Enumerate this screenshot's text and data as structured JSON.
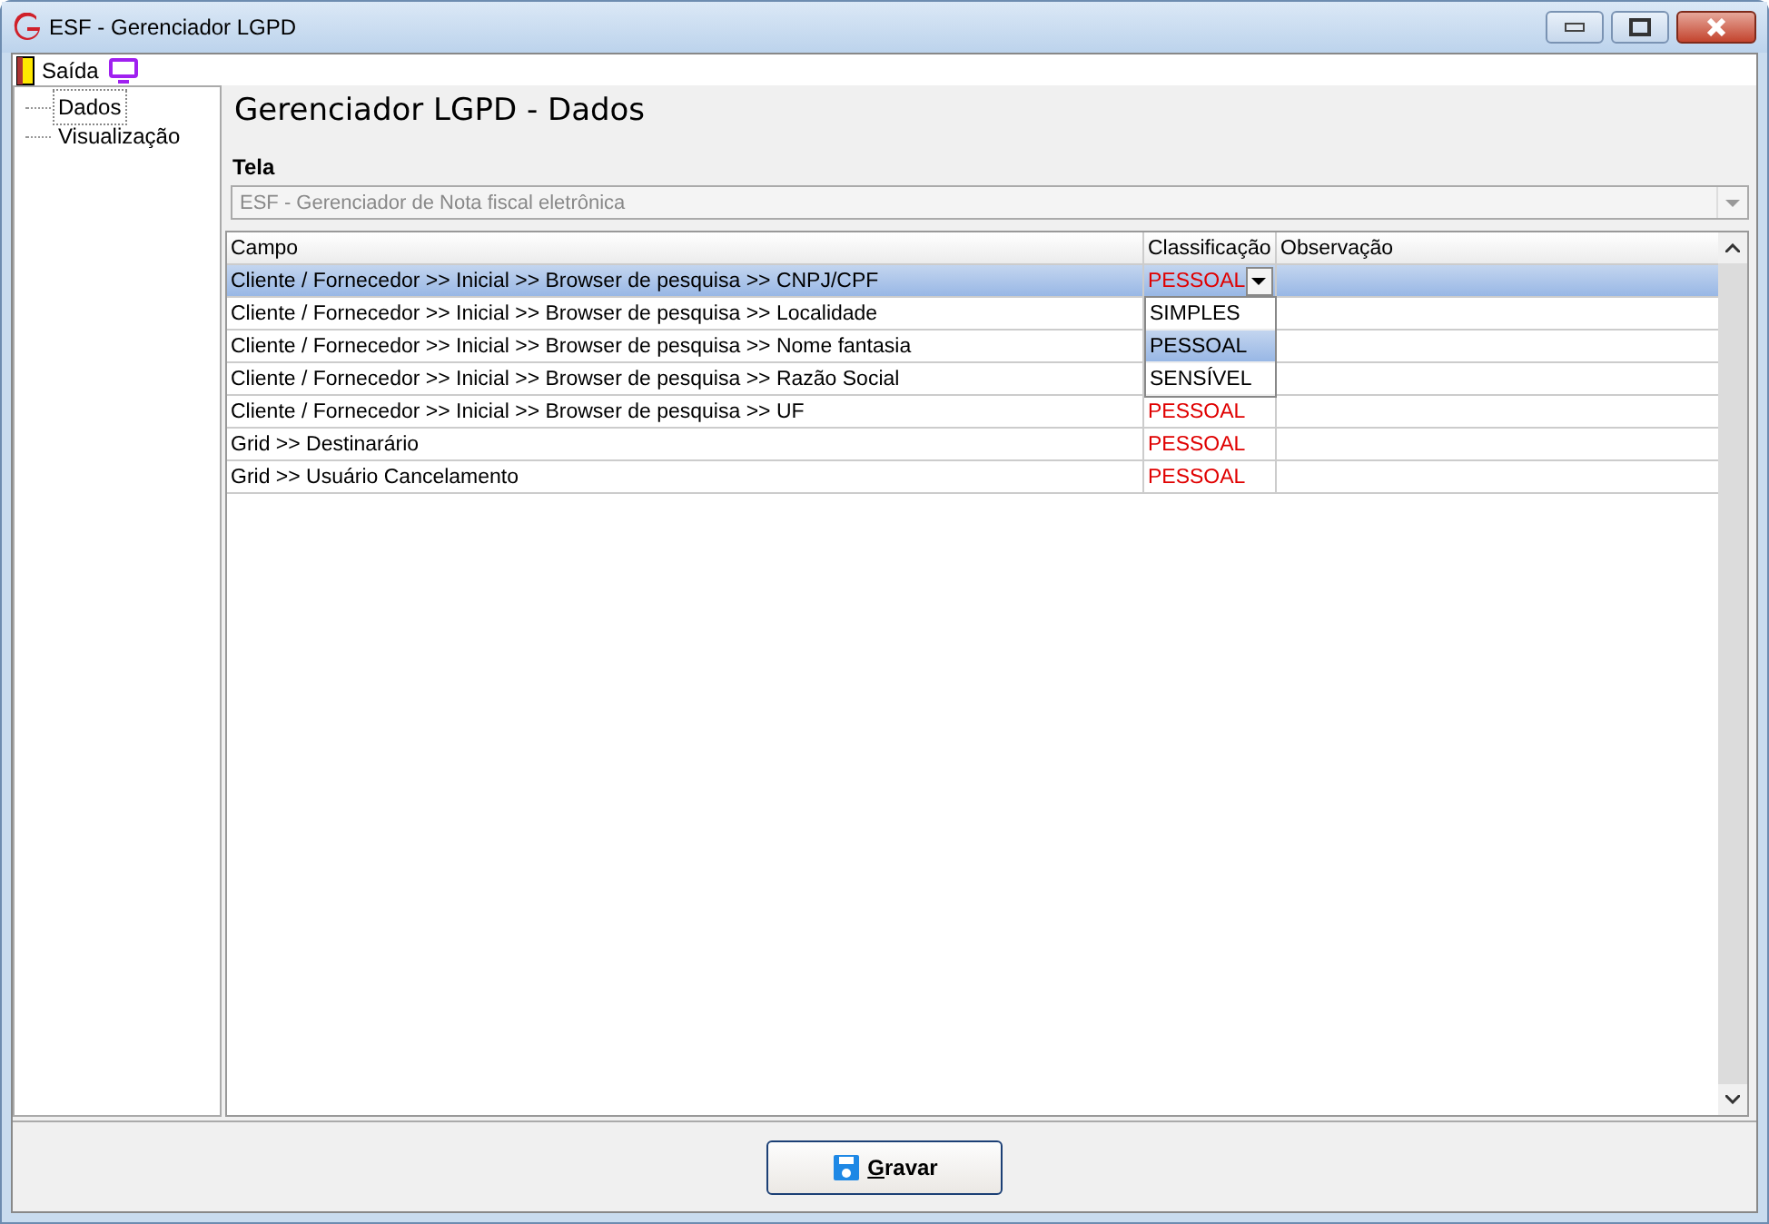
{
  "window": {
    "title": "ESF - Gerenciador LGPD"
  },
  "menu": [
    {
      "label": "Saída",
      "kind": "exit"
    },
    {
      "kind": "screen"
    }
  ],
  "sidebar": {
    "items": [
      {
        "label": "Dados",
        "selected": true
      },
      {
        "label": "Visualização",
        "selected": false
      }
    ]
  },
  "heading": "Gerenciador LGPD - Dados",
  "screen_field": {
    "label": "Tela",
    "value": "ESF - Gerenciador de Nota fiscal eletrônica",
    "disabled": true
  },
  "table": {
    "columns": [
      "Campo",
      "Classificação",
      "Observação"
    ],
    "rows": [
      {
        "campo": "Cliente / Fornecedor >> Inicial >> Browser de pesquisa >> CNPJ/CPF",
        "classificacao": "PESSOAL",
        "selected": true,
        "editing": true
      },
      {
        "campo": "Cliente / Fornecedor >> Inicial >> Browser de pesquisa >> Localidade",
        "selected": false,
        "editing": false
      },
      {
        "campo": "Cliente / Fornecedor >> Inicial >> Browser de pesquisa >> Nome fantasia",
        "selected": false,
        "editing": false
      },
      {
        "campo": "Cliente / Fornecedor >> Inicial >> Browser de pesquisa >> Razão Social",
        "selected": false,
        "editing": false
      },
      {
        "campo": "Cliente / Fornecedor >> Inicial >> Browser de pesquisa >> UF",
        "classificacao": "PESSOAL",
        "selected": false,
        "editing": false
      },
      {
        "campo": "Grid >> Destinarário",
        "classificacao": "PESSOAL",
        "selected": false,
        "editing": false
      },
      {
        "campo": "Grid >> Usuário Cancelamento",
        "classificacao": "PESSOAL",
        "selected": false,
        "editing": false
      }
    ],
    "dropdown": [
      {
        "label": "SIMPLES",
        "selected": false
      },
      {
        "label": "PESSOAL",
        "selected": true
      },
      {
        "label": "SENSÍVEL",
        "selected": false
      }
    ]
  },
  "save_button": {
    "label": "Gravar",
    "accesskey_underlined": true
  }
}
